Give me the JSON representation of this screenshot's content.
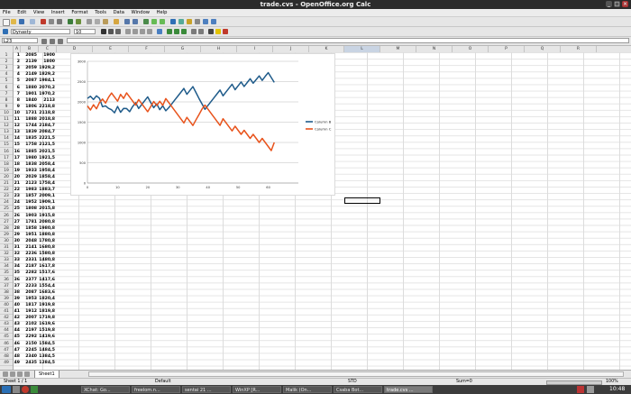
{
  "window": {
    "title": "trade.cvs - OpenOffice.org Calc"
  },
  "menu": [
    "File",
    "Edit",
    "View",
    "Insert",
    "Format",
    "Tools",
    "Data",
    "Window",
    "Help"
  ],
  "format_bar": {
    "font_name": "Dynasty",
    "font_size": "10"
  },
  "formula_bar": {
    "name_box": "L23",
    "content": ""
  },
  "columns": [
    "A",
    "B",
    "C",
    "D",
    "E",
    "F",
    "G",
    "H",
    "I",
    "J",
    "K",
    "L",
    "M",
    "N",
    "O",
    "P",
    "Q",
    "R"
  ],
  "rows": [
    [
      "1",
      "2085",
      "1900"
    ],
    [
      "2",
      "2139",
      "1800"
    ],
    [
      "3",
      "2059",
      "1929,2"
    ],
    [
      "4",
      "2149",
      "1829,2"
    ],
    [
      "5",
      "2087",
      "1984,1"
    ],
    [
      "6",
      "1880",
      "2070,2"
    ],
    [
      "7",
      "1901",
      "1970,2"
    ],
    [
      "8",
      "1840",
      "2113"
    ],
    [
      "9",
      "1806",
      "2218,8"
    ],
    [
      "10",
      "1731",
      "2118,8"
    ],
    [
      "11",
      "1888",
      "2018,8"
    ],
    [
      "12",
      "1744",
      "2184,7"
    ],
    [
      "13",
      "1839",
      "2084,7"
    ],
    [
      "14",
      "1835",
      "2221,5"
    ],
    [
      "15",
      "1758",
      "2121,5"
    ],
    [
      "16",
      "1885",
      "2021,5"
    ],
    [
      "17",
      "1980",
      "1921,5"
    ],
    [
      "18",
      "1838",
      "2058,4"
    ],
    [
      "19",
      "1933",
      "1958,4"
    ],
    [
      "20",
      "2029",
      "1858,4"
    ],
    [
      "21",
      "2123",
      "1758,4"
    ],
    [
      "22",
      "1983",
      "1883,7"
    ],
    [
      "23",
      "1857",
      "2009,1"
    ],
    [
      "24",
      "1952",
      "1909,1"
    ],
    [
      "25",
      "1808",
      "2015,8"
    ],
    [
      "26",
      "1903",
      "1915,8"
    ],
    [
      "27",
      "1781",
      "2080,8"
    ],
    [
      "28",
      "1858",
      "1980,8"
    ],
    [
      "29",
      "1951",
      "1880,8"
    ],
    [
      "30",
      "2048",
      "1780,8"
    ],
    [
      "31",
      "2141",
      "1680,8"
    ],
    [
      "32",
      "2236",
      "1580,8"
    ],
    [
      "33",
      "2331",
      "1480,8"
    ],
    [
      "34",
      "2187",
      "1617,8"
    ],
    [
      "35",
      "2282",
      "1517,6"
    ],
    [
      "36",
      "2377",
      "1417,6"
    ],
    [
      "37",
      "2233",
      "1554,4"
    ],
    [
      "38",
      "2087",
      "1683,6"
    ],
    [
      "39",
      "1953",
      "1820,4"
    ],
    [
      "40",
      "1817",
      "1919,8"
    ],
    [
      "41",
      "1912",
      "1819,8"
    ],
    [
      "42",
      "2007",
      "1719,8"
    ],
    [
      "43",
      "2102",
      "1619,6"
    ],
    [
      "44",
      "2197",
      "1519,8"
    ],
    [
      "45",
      "2292",
      "1419,6"
    ],
    [
      "46",
      "2150",
      "1584,5"
    ],
    [
      "47",
      "2245",
      "1484,5"
    ],
    [
      "48",
      "2340",
      "1384,5"
    ],
    [
      "49",
      "2435",
      "1284,5"
    ]
  ],
  "chart_data": {
    "type": "line",
    "x_ticks": [
      "0",
      "10",
      "20",
      "30",
      "40",
      "50",
      "60"
    ],
    "y_ticks": [
      "3000",
      "2500",
      "2000",
      "1500",
      "1000",
      "500",
      "0"
    ],
    "xlim": [
      0,
      70
    ],
    "ylim": [
      0,
      3000
    ],
    "series": [
      {
        "name": "Column B",
        "color": "#1f5b8a",
        "values": [
          2085,
          2139,
          2059,
          2149,
          2087,
          1880,
          1901,
          1840,
          1806,
          1731,
          1888,
          1744,
          1839,
          1835,
          1758,
          1885,
          1980,
          1838,
          1933,
          2029,
          2123,
          1983,
          1857,
          1952,
          1808,
          1903,
          1781,
          1858,
          1951,
          2048,
          2141,
          2236,
          2331,
          2187,
          2282,
          2377,
          2233,
          2087,
          1953,
          1817,
          1912,
          2007,
          2102,
          2197,
          2292,
          2150,
          2245,
          2340,
          2435,
          2300,
          2395,
          2490,
          2380,
          2475,
          2570,
          2460,
          2550,
          2640,
          2530,
          2630,
          2720,
          2600,
          2480
        ]
      },
      {
        "name": "Column C",
        "color": "#e8531c",
        "values": [
          1900,
          1800,
          1929,
          1829,
          1984,
          2070,
          1970,
          2113,
          2219,
          2119,
          2019,
          2185,
          2085,
          2222,
          2122,
          2022,
          1922,
          2058,
          1958,
          1858,
          1758,
          1884,
          2009,
          1909,
          2016,
          1916,
          2081,
          1981,
          1881,
          1781,
          1681,
          1581,
          1481,
          1618,
          1518,
          1418,
          1554,
          1684,
          1820,
          1920,
          1820,
          1720,
          1620,
          1520,
          1420,
          1585,
          1485,
          1385,
          1285,
          1400,
          1300,
          1200,
          1300,
          1200,
          1100,
          1200,
          1100,
          1000,
          1100,
          1000,
          900,
          800,
          1000
        ]
      }
    ]
  },
  "sheet_tab": "Sheet1",
  "status": {
    "sheet": "Sheet 1 / 1",
    "style": "Default",
    "mode": "STD",
    "sum": "Sum=0",
    "zoom": "100%"
  },
  "taskbar": {
    "items": [
      "XChat: Go...",
      "freelom.n...",
      "sentai 21 ...",
      "WinXP [R...",
      "Malik (On...",
      "Csaba Bot...",
      "trade.cvs ..."
    ],
    "clock": "10:48"
  }
}
